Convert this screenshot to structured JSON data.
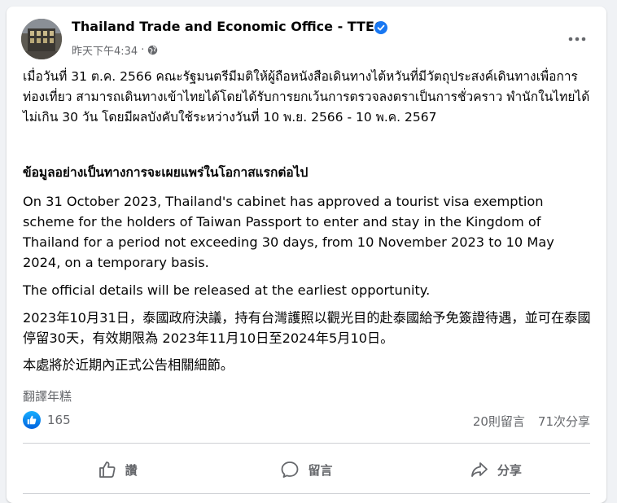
{
  "post": {
    "page_name": "Thailand Trade and Economic Office - TTEO",
    "timestamp": "昨天下午4:34",
    "separator": "·",
    "paragraphs": {
      "thai_1": "เมื่อวันที่ 31 ต.ค. 2566 คณะรัฐมนตรีมีมติให้ผู้ถือหนังสือเดินทางไต้หวันที่มีวัตถุประสงค์เดินทางเพื่อการท่องเที่ยว สามารถเดินทางเข้าไทยได้โดยได้รับการยกเว้นการตรวจลงตราเป็นการชั่วคราว พำนักในไทยได้ไม่เกิน 30 วัน โดยมีผลบังคับใช้ระหว่างวันที่ 10 พ.ย. 2566 - 10 พ.ค. 2567",
      "thai_2": "ข้อมูลอย่างเป็นทางการจะเผยแพร่ในโอกาสแรกต่อไป",
      "en_1": "On 31 October 2023, Thailand's cabinet has approved a tourist visa exemption scheme for the holders of Taiwan Passport to enter and stay in the Kingdom of Thailand for a period not exceeding 30 days, from 10 November 2023 to 10 May 2024, on a temporary basis.",
      "en_2": "The official details will be released at the earliest opportunity.",
      "zh_1": "2023年10月31日，泰國政府決議，持有台灣護照以觀光目的赴泰國給予免簽證待遇，並可在泰國停留30天，有效期限為 2023年11月10日至2024年5月10日。",
      "zh_2": "本處將於近期內正式公告相關細節。"
    },
    "translate_label": "翻譯年糕",
    "reactions_count": "165",
    "comments_count": "20則留言",
    "shares_count": "71次分享"
  },
  "actions": {
    "like_label": "讚",
    "comment_label": "留言",
    "share_label": "分享"
  },
  "colors": {
    "facebook_blue": "#1877f2",
    "secondary_text": "#65676b"
  }
}
